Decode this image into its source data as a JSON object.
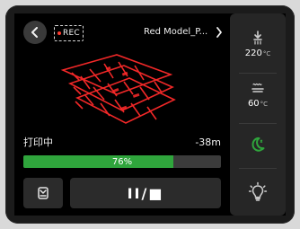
{
  "header": {
    "rec_label": "REC",
    "file_name": "Red Model_P...",
    "icons": {
      "back": "chevron-left-icon",
      "file_open": "chevron-right-icon"
    }
  },
  "thumbnail": {
    "alt": "Red Model_P..."
  },
  "status": {
    "text": "打印中",
    "time_remaining": "-38m"
  },
  "progress": {
    "percent": 76,
    "label": "76%"
  },
  "controls": {
    "left_icon": "print-bed-icon",
    "pause_stop_label": "II/■"
  },
  "sidebar": {
    "nozzle": {
      "icon": "nozzle-icon",
      "value": "220",
      "unit": "°C"
    },
    "bed": {
      "icon": "heated-bed-icon",
      "value": "60",
      "unit": "°C"
    },
    "mode": {
      "icon": "moon-icon"
    },
    "light": {
      "icon": "lightbulb-icon"
    }
  },
  "colors": {
    "accent_green": "#2fa53c",
    "rec_dot": "#ff3b30",
    "model_red": "#ff2b2b",
    "panel": "#262626"
  }
}
